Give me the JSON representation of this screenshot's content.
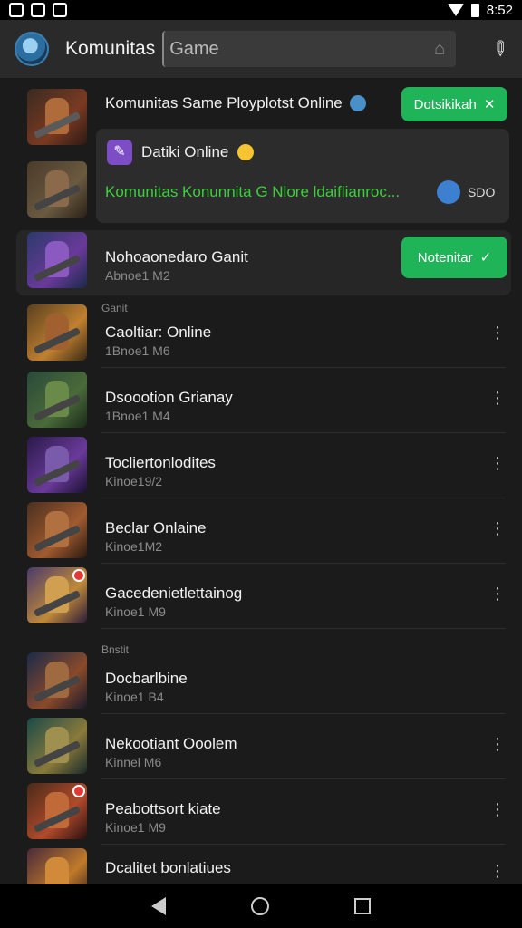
{
  "status": {
    "time": "8:52"
  },
  "appbar": {
    "title": "Komunitas",
    "search_value": "Game"
  },
  "featured": {
    "title": "Komunitas Same Ployplotst Online",
    "button_label": "Dotsikikah",
    "promo": {
      "title": "Datiki Online",
      "text": "Komunitas Konunnita G Nlore ldaiflianroc...",
      "value": "SDO"
    }
  },
  "highlight": {
    "title": "Nohoaonedaro Ganit",
    "subtitle": "Abnoe1 M2",
    "button_label": "Notenitar"
  },
  "sections": [
    {
      "label": "Ganit",
      "items": [
        {
          "title": "Caoltiar: Online",
          "subtitle": "1Bnoe1 M6"
        },
        {
          "title": "Dsoootion Grianay",
          "subtitle": "1Bnoe1 M4"
        },
        {
          "title": "Tocliertonlodites",
          "subtitle": "Kinoe19/2"
        },
        {
          "title": "Beclar Onlaine",
          "subtitle": "Kinoe1M2"
        },
        {
          "title": "Gacedenietlettainog",
          "subtitle": "Kinoe1 M9"
        }
      ]
    },
    {
      "label": "Bnstit",
      "items": [
        {
          "title": "Docbarlbine",
          "subtitle": "Kinoe1 B4"
        },
        {
          "title": "Nekootiant Ooolem",
          "subtitle": "Kinnel M6"
        },
        {
          "title": "Peabottsort kiate",
          "subtitle": "Kinoe1 M9"
        },
        {
          "title": "Dcalitet bonlatiues",
          "subtitle": ""
        }
      ]
    }
  ],
  "colors": {
    "accent_green": "#1fb457",
    "green_text": "#3ccf3c",
    "background": "#1b1b1b"
  }
}
